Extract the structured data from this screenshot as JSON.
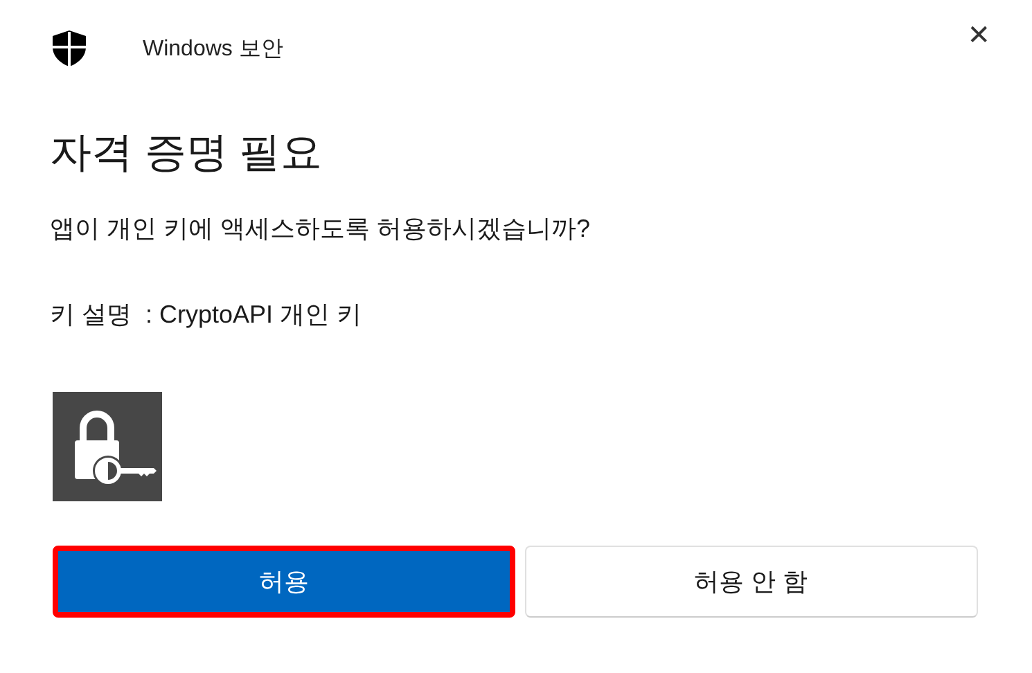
{
  "window": {
    "title": "Windows 보안",
    "close": "✕"
  },
  "heading": "자격 증명 필요",
  "question": "앱이 개인 키에 액세스하도록 허용하시겠습니까?",
  "key_description": {
    "label": "키 설명",
    "value": ": CryptoAPI 개인 키"
  },
  "buttons": [
    {
      "label": "허용",
      "kind": "primary",
      "highlighted": true
    },
    {
      "label": "허용 안 함",
      "kind": "secondary",
      "highlighted": false
    }
  ]
}
